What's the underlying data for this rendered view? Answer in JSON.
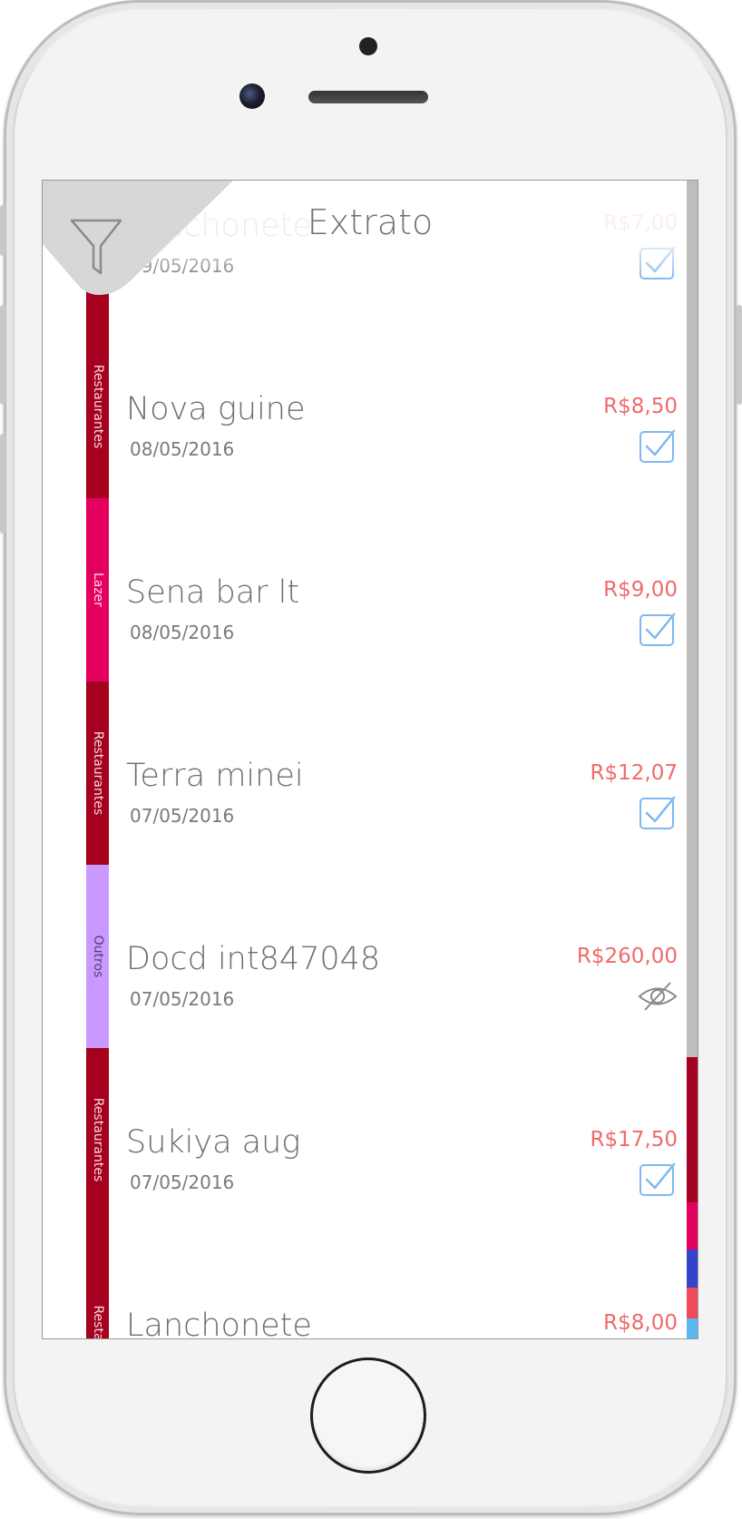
{
  "header": {
    "title": "Extrato"
  },
  "colors": {
    "restaurantes": "#a5001e",
    "lazer": "#e3005f",
    "outros": "#c999ff",
    "amount": "#f06a6a",
    "check": "#7fb8f0"
  },
  "transactions": [
    {
      "name": "Lanchonete",
      "date": "09/05/2016",
      "amount": "R$7,00",
      "category": "",
      "status": "check-icon"
    },
    {
      "name": "Nova guine",
      "date": "08/05/2016",
      "amount": "R$8,50",
      "category": "Restaurantes",
      "status": "check-icon"
    },
    {
      "name": "Sena bar lt",
      "date": "08/05/2016",
      "amount": "R$9,00",
      "category": "Lazer",
      "status": "check-icon"
    },
    {
      "name": "Terra minei",
      "date": "07/05/2016",
      "amount": "R$12,07",
      "category": "Restaurantes",
      "status": "check-icon"
    },
    {
      "name": "Docd int847048",
      "date": "07/05/2016",
      "amount": "R$260,00",
      "category": "Outros",
      "status": "eye-off-icon"
    },
    {
      "name": "Sukiya  aug",
      "date": "07/05/2016",
      "amount": "R$17,50",
      "category": "Restaurantes",
      "status": "check-icon"
    },
    {
      "name": "Lanchonete",
      "date": "",
      "amount": "R$8,00",
      "category": "Resta",
      "status": ""
    }
  ]
}
